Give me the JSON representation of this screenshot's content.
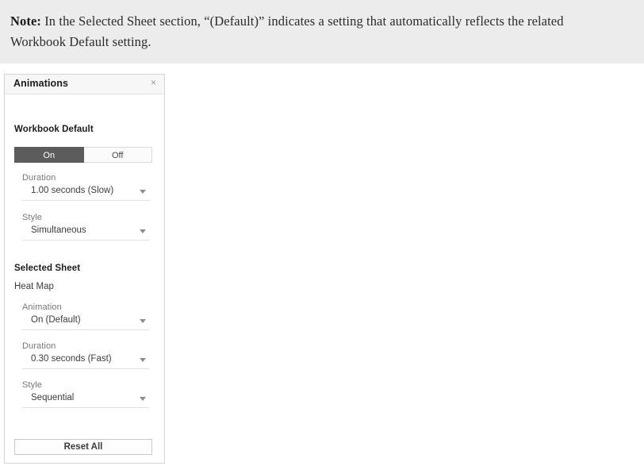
{
  "note": {
    "label": "Note:",
    "text": " In the Selected Sheet section, “(Default)” indicates a setting that automatically reflects the related Workbook Default setting."
  },
  "panel": {
    "title": "Animations",
    "close_icon": "×",
    "workbook_default": {
      "section_title": "Workbook Default",
      "toggle": {
        "on_label": "On",
        "off_label": "Off",
        "selected": "On"
      },
      "duration": {
        "label": "Duration",
        "value": "1.00 seconds (Slow)"
      },
      "style": {
        "label": "Style",
        "value": "Simultaneous"
      }
    },
    "selected_sheet": {
      "section_title": "Selected Sheet",
      "sheet_name": "Heat Map",
      "animation": {
        "label": "Animation",
        "value": "On (Default)"
      },
      "duration": {
        "label": "Duration",
        "value": "0.30 seconds (Fast)"
      },
      "style": {
        "label": "Style",
        "value": "Sequential"
      }
    },
    "reset_label": "Reset All"
  },
  "colors": {
    "note_band": "#ececec",
    "toggle_selected": "#5c5c5c",
    "panel_border": "#d4d4d4",
    "label_gray": "#767676"
  }
}
